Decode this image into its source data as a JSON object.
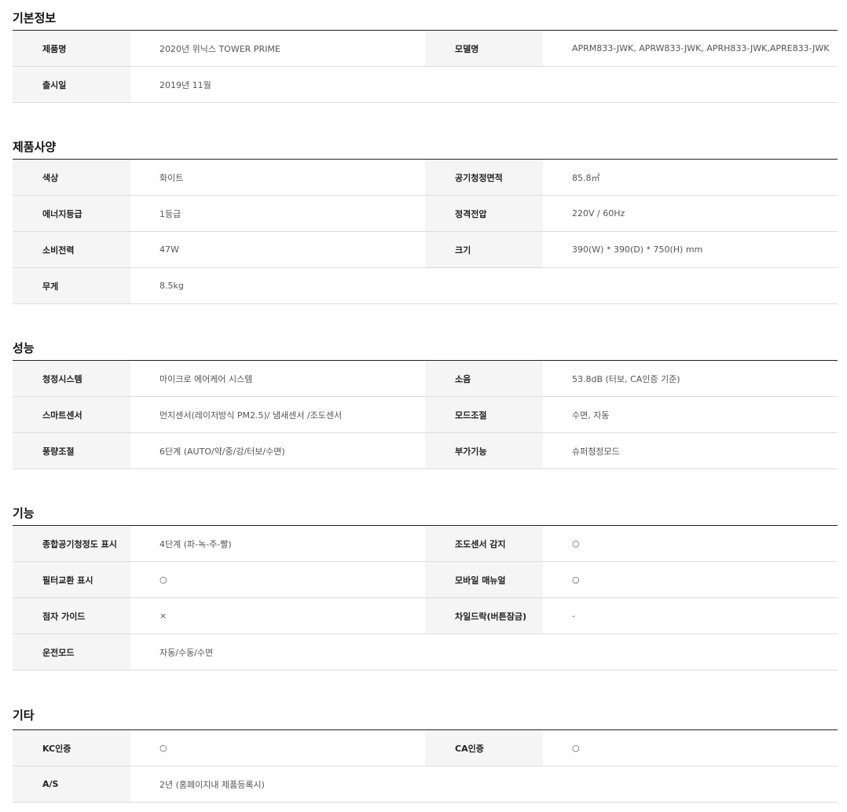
{
  "sections": [
    {
      "title": "기본정보",
      "rows": [
        {
          "cells": [
            {
              "label": "제품명",
              "value": "2020년 위닉스 TOWER PRIME"
            },
            {
              "label": "모델명",
              "value": "APRM833-JWK, APRW833-JWK, APRH833-JWK,APRE833-JWK"
            }
          ]
        },
        {
          "cells": [
            {
              "label": "출시일",
              "value": "2019년 11월"
            }
          ]
        }
      ]
    },
    {
      "title": "제품사양",
      "rows": [
        {
          "cells": [
            {
              "label": "색상",
              "value": "화이트"
            },
            {
              "label": "공기청정면적",
              "value": "85.8㎡"
            }
          ]
        },
        {
          "cells": [
            {
              "label": "에너지등급",
              "value": "1등급"
            },
            {
              "label": "정격전압",
              "value": "220V / 60Hz"
            }
          ]
        },
        {
          "cells": [
            {
              "label": "소비전력",
              "value": "47W"
            },
            {
              "label": "크기",
              "value": "390(W) * 390(D) * 750(H) mm"
            }
          ]
        },
        {
          "cells": [
            {
              "label": "무게",
              "value": "8.5kg"
            }
          ]
        }
      ]
    },
    {
      "title": "성능",
      "rows": [
        {
          "cells": [
            {
              "label": "청정시스템",
              "value": "마이크로 에어케어 시스템"
            },
            {
              "label": "소음",
              "value": "53.8dB (터보, CA인증 기준)"
            }
          ]
        },
        {
          "cells": [
            {
              "label": "스마트센서",
              "value": "먼지센서(레이저방식 PM2.5)/ 냄새센서 /조도센서"
            },
            {
              "label": "모드조절",
              "value": "수면, 자동"
            }
          ]
        },
        {
          "cells": [
            {
              "label": "풍량조절",
              "value": "6단계 (AUTO/약/중/강/터보/수면)"
            },
            {
              "label": "부가기능",
              "value": "슈퍼청정모드"
            }
          ]
        }
      ]
    },
    {
      "title": "기능",
      "rows": [
        {
          "cells": [
            {
              "label": "종합공기청정도 표시",
              "value": "4단계 (파-녹-주-빨)"
            },
            {
              "label": "조도센서 감지",
              "value": "○"
            }
          ]
        },
        {
          "cells": [
            {
              "label": "필터교환 표시",
              "value": "○"
            },
            {
              "label": "모바일 매뉴얼",
              "value": "○"
            }
          ]
        },
        {
          "cells": [
            {
              "label": "점자 가이드",
              "value": "×"
            },
            {
              "label": "차일드락(버튼잠금)",
              "value": "-"
            }
          ]
        },
        {
          "cells": [
            {
              "label": "운전모드",
              "value": "자동/수동/수면"
            }
          ]
        }
      ]
    },
    {
      "title": "기타",
      "rows": [
        {
          "cells": [
            {
              "label": "KC인증",
              "value": "○"
            },
            {
              "label": "CA인증",
              "value": "○"
            }
          ]
        },
        {
          "cells": [
            {
              "label": "A/S",
              "value": "2년 (홈페이지내 제품등록시)"
            }
          ]
        }
      ]
    }
  ]
}
